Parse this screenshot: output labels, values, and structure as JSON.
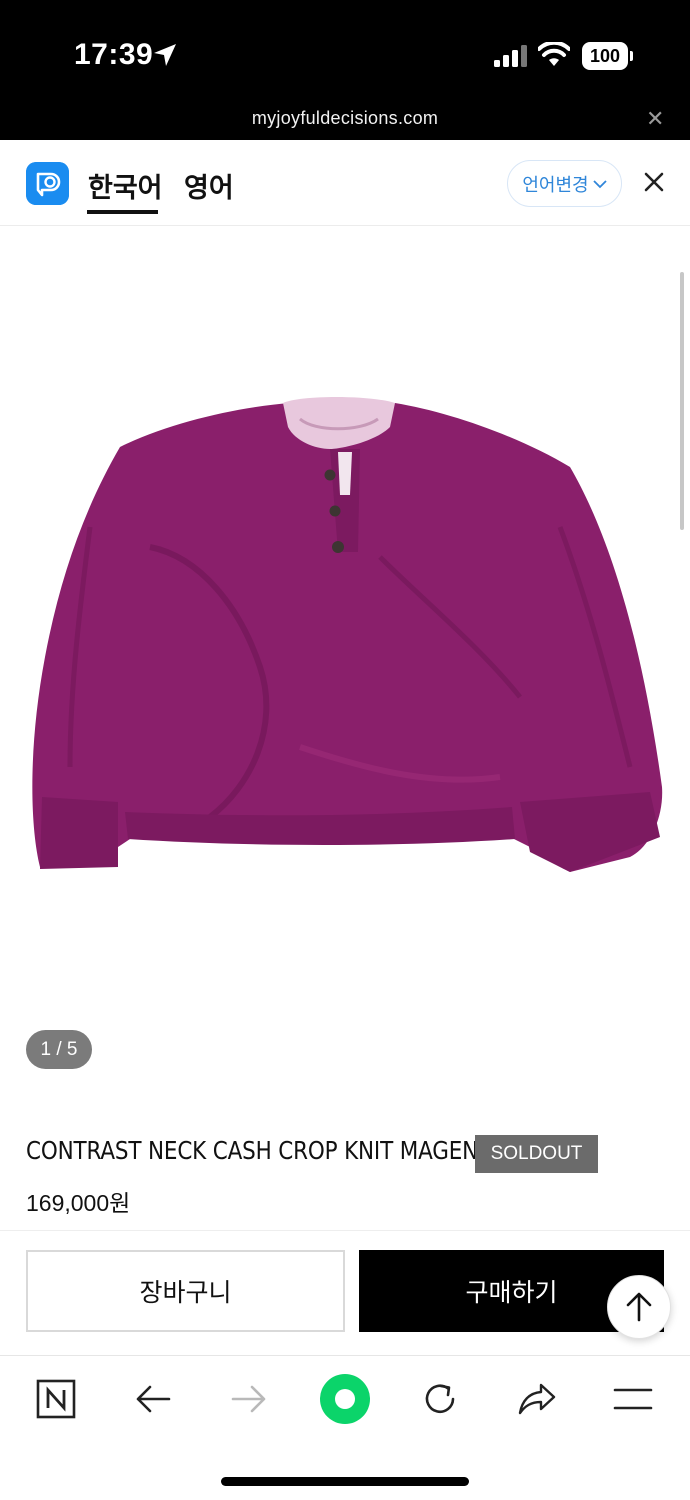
{
  "status_bar": {
    "time": "17:39",
    "battery": "100",
    "icons": [
      "location-arrow-icon",
      "cellular-signal-icon",
      "wifi-icon",
      "battery-icon"
    ]
  },
  "url_bar": {
    "url": "myjoyfuldecisions.com",
    "close_glyph": "✕"
  },
  "translate_bar": {
    "tabs": [
      {
        "label": "한국어",
        "active": true
      },
      {
        "label": "영어",
        "active": false
      }
    ],
    "change_language_label": "언어변경",
    "accent_color": "#1a8cf0"
  },
  "product": {
    "image_counter": "1 / 5",
    "name": "CONTRAST NECK CASH CROP KNIT MAGENTA",
    "badge": "SOLDOUT",
    "price": "169,000원",
    "sweater_color": "#8c1f6c",
    "collar_color": "#e8c8dd"
  },
  "actions": {
    "cart_label": "장바구니",
    "buy_label": "구매하기"
  },
  "browser_toolbar": {
    "items": [
      "naver-home-icon",
      "back-arrow-icon",
      "forward-arrow-icon",
      "green-dot-icon",
      "reload-icon",
      "share-icon",
      "menu-icon"
    ]
  }
}
